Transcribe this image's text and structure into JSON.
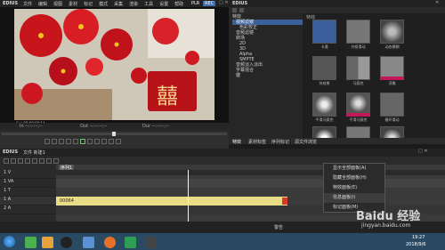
{
  "player": {
    "app_name": "EDIUS",
    "menu": [
      "文件",
      "编辑",
      "视图",
      "素材",
      "标记",
      "模式",
      "采集",
      "渲染",
      "工具",
      "设置",
      "帮助"
    ],
    "mode_badge": "PLR",
    "rec_badge": "REC",
    "timecode_left": "Cur 00:00:00;14",
    "timecode_mid": "In --:--:--;--",
    "timecode_right": "Out --:--:--;--",
    "duration": "Dur --:--:--;--",
    "preview_caption": "囍"
  },
  "effects": {
    "app_name": "EDIUS",
    "panel_title": "特效",
    "tree": [
      "特效",
      "视频滤镜",
      "色彩校正",
      "音频滤镜",
      "转场",
      "2D",
      "3D",
      "Alpha",
      "SMPTE",
      "音频淡入淡出",
      "字幕混合",
      "键"
    ],
    "items": [
      {
        "label": "卡通"
      },
      {
        "label": "内框滑动"
      },
      {
        "label": "动态模糊"
      },
      {
        "label": "块效果"
      },
      {
        "label": "马赛克"
      },
      {
        "label": "浮雕"
      },
      {
        "label": "平滑马赛克"
      },
      {
        "label": "平滑马赛克"
      },
      {
        "label": "循环滑动"
      },
      {
        "label": "打开/合并"
      },
      {
        "label": "平滑溶化"
      },
      {
        "label": "Blur"
      }
    ],
    "tabs": [
      "特效",
      "素材标签",
      "序列标记",
      "源文件浏览"
    ]
  },
  "timeline": {
    "app_name": "EDIUS",
    "project_label": "文件 新建1",
    "sequence_tab": "序列1",
    "clip_name": "00064",
    "tracks": [
      "1 V",
      "1 VA",
      "1 T",
      "1 A",
      "2 A"
    ]
  },
  "context_menu": {
    "items": [
      "显示全部面板(A)",
      "隐藏全部面板(H)",
      "特效面板(E)",
      "信息面板(I)",
      "标记面板(M)"
    ]
  },
  "status": {
    "text": "警告"
  },
  "taskbar": {
    "time": "19:27",
    "date": "2018/9/6"
  },
  "watermark": {
    "brand": "Baidu 经验",
    "url": "jingyan.baidu.com"
  },
  "colors": {
    "clip_fill": "#e8dc86",
    "playhead": "#f2f2f2",
    "selected_tree": "#3a5f9a",
    "taskbar_bg": "#2a4a63"
  }
}
